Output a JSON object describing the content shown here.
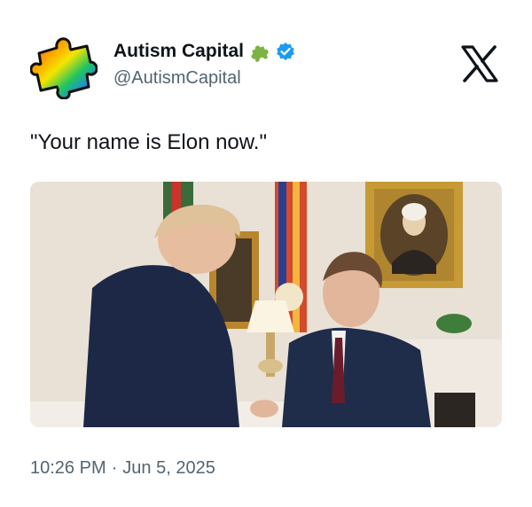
{
  "account": {
    "display_name": "Autism Capital",
    "handle": "@AutismCapital",
    "avatar_icon": "rainbow-puzzle-piece-icon",
    "badge_icons": [
      "green-puzzle-piece-icon",
      "verified-check-icon"
    ],
    "verified_color": "#1d9bf0"
  },
  "header": {
    "logo_icon": "x-logo-icon"
  },
  "tweet": {
    "text": "\"Your name is Elon now.\""
  },
  "media": {
    "type": "photo"
  },
  "meta": {
    "time": "10:26 PM",
    "separator": "·",
    "date": "Jun 5, 2025"
  }
}
